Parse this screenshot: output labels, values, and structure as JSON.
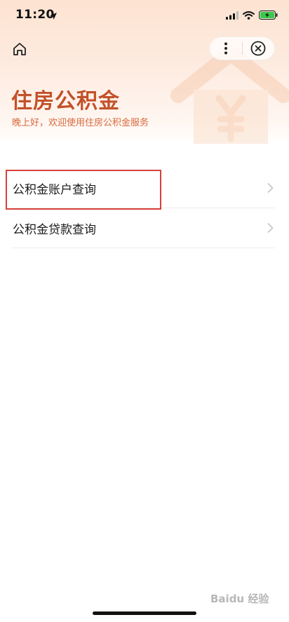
{
  "status_bar": {
    "time": "11:20"
  },
  "header": {
    "title": "住房公积金",
    "subtitle": "晚上好，欢迎使用住房公积金服务"
  },
  "menu": [
    {
      "label": "公积金账户查询"
    },
    {
      "label": "公积金贷款查询"
    }
  ],
  "watermark": {
    "text": "Baidu 经验"
  },
  "colors": {
    "title": "#c2522a",
    "subtitle": "#d8693c",
    "highlight": "#d9403a",
    "header_gradient_top": "#fde3d1"
  },
  "icons": {
    "home": "home-icon",
    "more": "more-dots-icon",
    "close": "close-circle-icon",
    "chevron": "chevron-right-icon"
  }
}
